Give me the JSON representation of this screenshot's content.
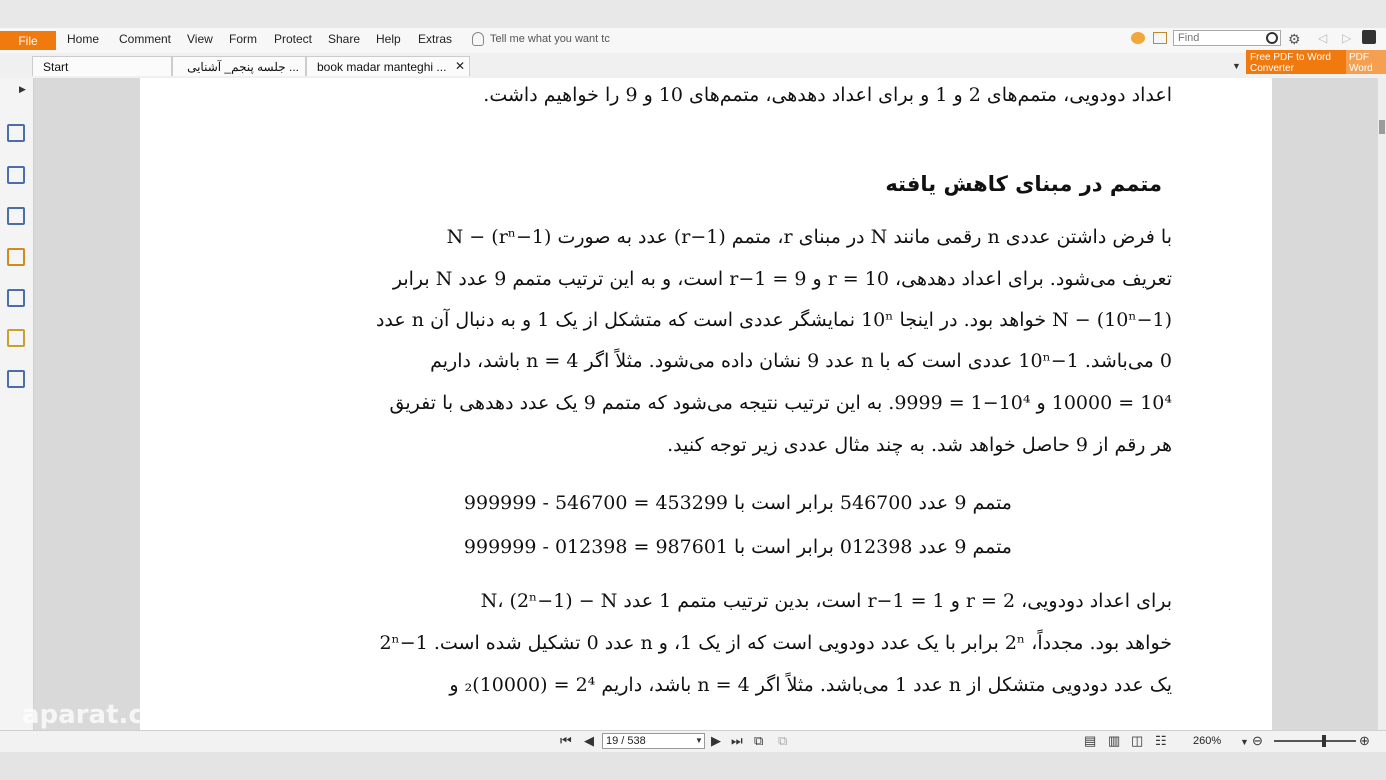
{
  "ribbon": {
    "file": "File",
    "menu": [
      "Home",
      "Comment",
      "View",
      "Form",
      "Protect",
      "Share",
      "Help",
      "Extras"
    ],
    "tell_me": "Tell me what you want tc",
    "find_placeholder": "Find"
  },
  "tabs": [
    {
      "label": "Start"
    },
    {
      "label": "... جلسه پنجم_ آشنایی"
    },
    {
      "label": "book madar manteghi ..."
    }
  ],
  "promo": {
    "line1": "Free PDF to Word",
    "line2": "Converter",
    "side1": "PDF",
    "side2": "Word"
  },
  "document": {
    "lines_top": [
      "اعداد دودویی، متمم‌های 2 و 1 و برای اعداد دهدهی، متمم‌های 10 و 9 را خواهیم داشت."
    ],
    "heading": "متمم در مبنای کاهش یافته",
    "paragraph1": [
      "با فرض داشتن عددی n رقمی مانند N در مبنای r، متمم (r−1) عدد به صورت (rⁿ−1) − N",
      "تعریف می‌شود. برای اعداد دهدهی، r = 10 و r−1 = 9 است، و به این ترتیب متمم 9 عدد N برابر",
      "(10ⁿ−1) − N خواهد بود. در اینجا 10ⁿ نمایشگر عددی است که متشکل از یک 1 و به دنبال آن n عدد",
      "0 می‌باشد. 10ⁿ−1 عددی است که با n عدد 9 نشان داده می‌شود. مثلاً اگر n = 4 باشد، داریم",
      "10⁴ = 10000 و 10⁴−1 = 9999. به این ترتیب نتیجه می‌شود که متمم 9 یک عدد دهدهی با تفریق",
      "هر رقم از 9 حاصل خواهد شد. به چند مثال عددی زیر توجه کنید."
    ],
    "examples": [
      "متمم 9 عدد 546700 برابر است با 453299 = 546700 - 999999",
      "متمم 9 عدد 012398 برابر است با 987601 = 012398 - 999999"
    ],
    "paragraph2": [
      "برای اعداد دودویی، r = 2 و r−1 = 1 است، بدین ترتیب متمم 1 عدد N، (2ⁿ−1) − N",
      "خواهد بود. مجدداً، 2ⁿ برابر با یک عدد دودویی است که از یک 1، و n عدد 0 تشکیل شده است. 2ⁿ−1",
      "یک عدد دودویی متشکل از n عدد 1 می‌باشد. مثلاً اگر n = 4 باشد، داریم 2⁴ = (10000)₂ و"
    ]
  },
  "watermark": "aparat.c",
  "status": {
    "page": "19 / 538",
    "zoom": "260%"
  }
}
